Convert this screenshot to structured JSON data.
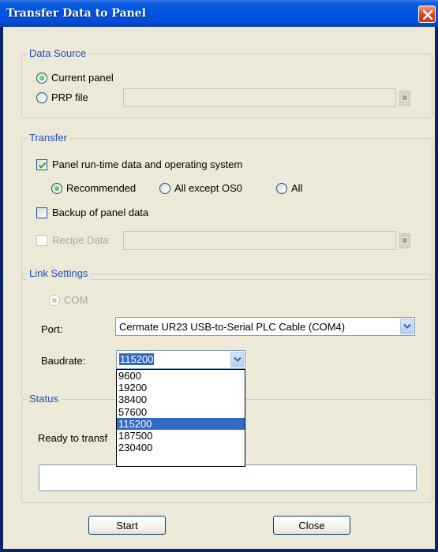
{
  "window": {
    "title": "Transfer Data to Panel",
    "close_icon": "close-icon"
  },
  "data_source": {
    "legend": "Data Source",
    "current_panel_label": "Current panel",
    "prp_file_label": "PRP file",
    "prp_file_value": "",
    "selected": "Current panel"
  },
  "transfer": {
    "legend": "Transfer",
    "runtime_label": "Panel run-time data and operating system",
    "runtime_checked": true,
    "recommended_label": "Recommended",
    "all_except_os_label": "All except OS0",
    "all_label": "All",
    "selected_mode": "Recommended",
    "backup_label": "Backup of panel data",
    "backup_checked": false,
    "recipe_label": "Recipe Data",
    "recipe_value": ""
  },
  "link": {
    "legend": "Link Settings",
    "com_label": "COM",
    "port_label": "Port:",
    "port_value": "Cermate UR23 USB-to-Serial PLC Cable (COM4)",
    "baudrate_label": "Baudrate:",
    "baudrate_value": "115200",
    "baudrate_options": [
      "9600",
      "19200",
      "38400",
      "57600",
      "115200",
      "187500",
      "230400"
    ]
  },
  "status": {
    "legend": "Status",
    "message": "Ready to transf",
    "progress": 0
  },
  "buttons": {
    "start": "Start",
    "close": "Close"
  },
  "colors": {
    "titlebar": "#0054e3",
    "accent": "#316ac5",
    "group_legend": "#1c4fb8",
    "dialog_bg": "#ece9d8"
  }
}
